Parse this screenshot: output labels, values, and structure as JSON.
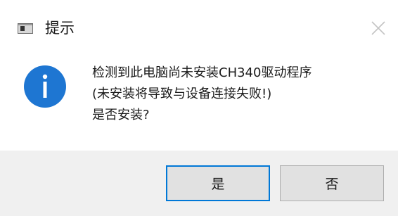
{
  "dialog": {
    "title": "提示",
    "app_icon": "app-window-icon",
    "close_icon": "close-icon",
    "message_icon": "info-icon",
    "message_lines": [
      "检测到此电脑尚未安装CH340驱动程序",
      "(未安装将导致与设备连接失败!)",
      "是否安装?"
    ],
    "buttons": {
      "yes_label": "是",
      "no_label": "否"
    },
    "accent_color": "#0078d7",
    "info_color": "#1e76d2"
  }
}
